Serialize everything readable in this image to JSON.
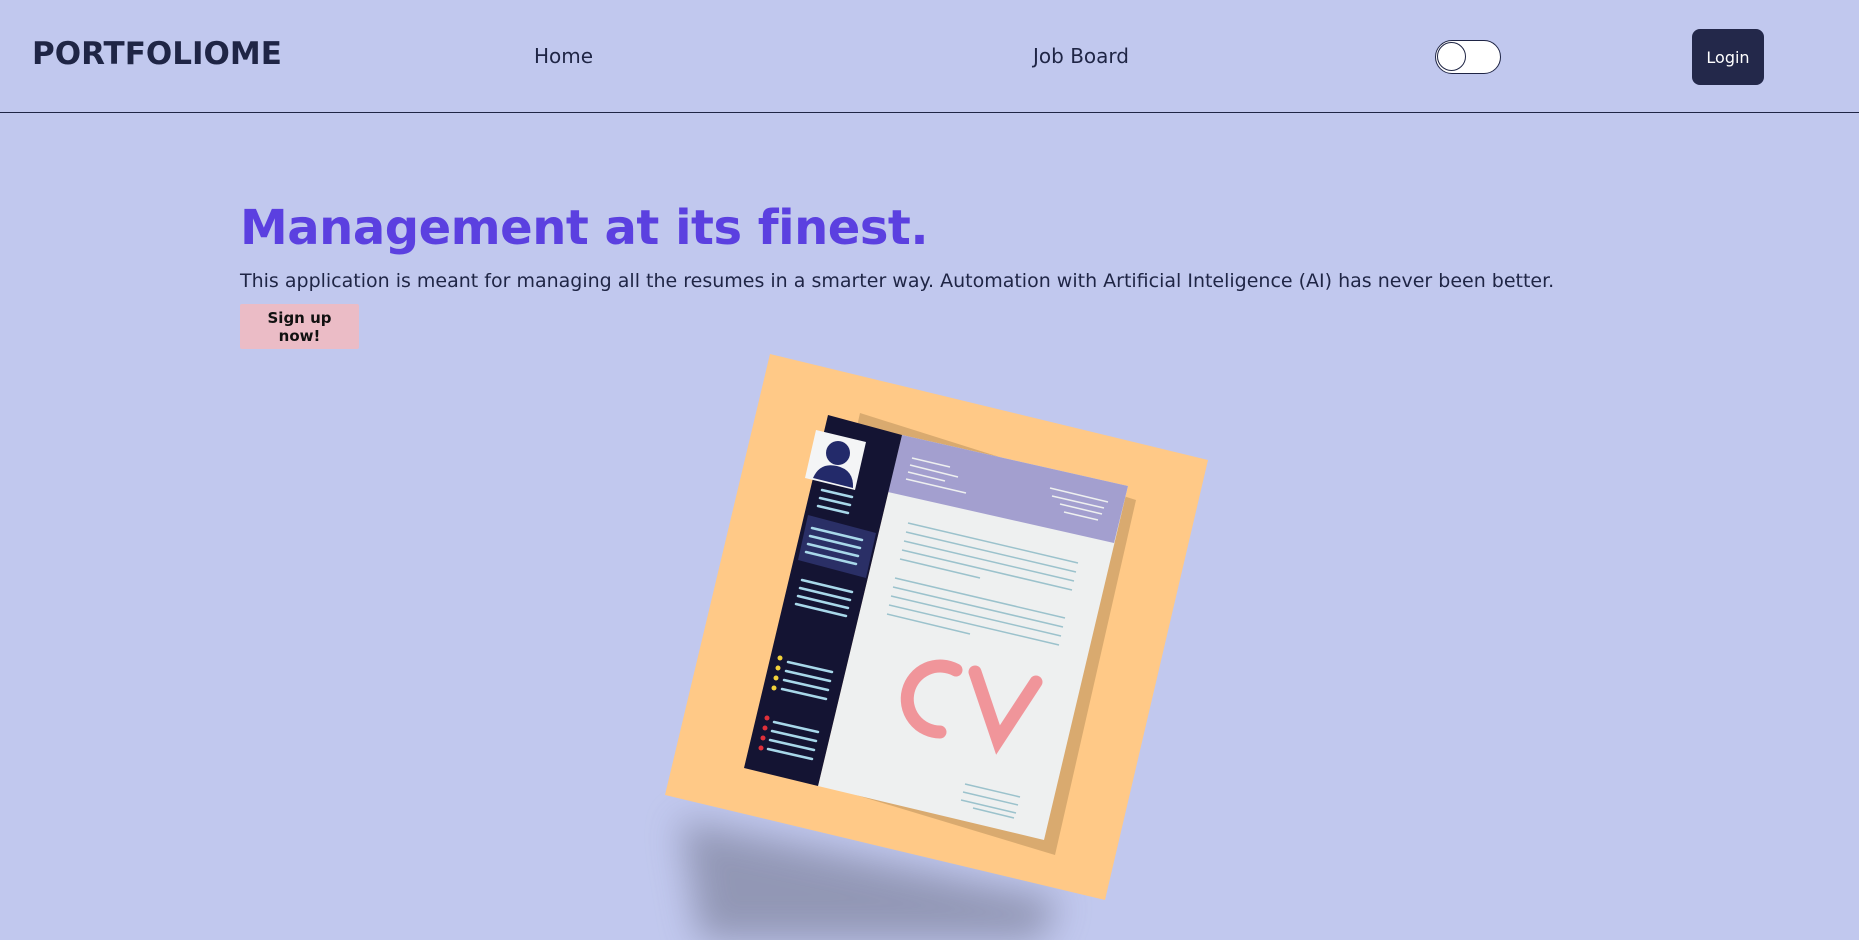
{
  "nav": {
    "brand": "PORTFOLIOME",
    "links": [
      "Home",
      "Job Board"
    ],
    "login_label": "Login",
    "theme_toggle": "off"
  },
  "hero": {
    "title": "Management at its finest.",
    "subtitle": "This application is meant for managing all the resumes in a smarter way. Automation with Artificial Inteligence (AI) has never been better.",
    "cta_label": "Sign up now!"
  },
  "illustration": {
    "text": "CV",
    "icon": "cv-document-illustration"
  },
  "colors": {
    "background": "#c1c8ee",
    "accent": "#5b40e0",
    "dark": "#23284a",
    "cta": "#ebbcc6",
    "cv_card": "#ffc987",
    "cv_letters": "#f0959a"
  }
}
